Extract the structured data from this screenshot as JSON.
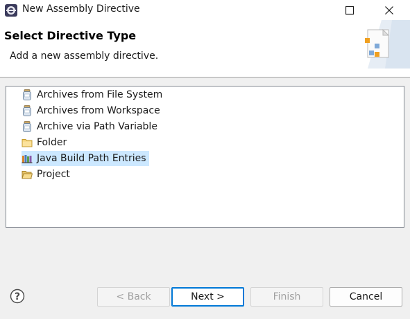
{
  "window": {
    "title": "New Assembly Directive"
  },
  "header": {
    "title": "Select Directive Type",
    "description": "Add a new assembly directive."
  },
  "list": {
    "items": [
      {
        "label": "Archives from File System",
        "icon": "jar-icon"
      },
      {
        "label": "Archives from Workspace",
        "icon": "jar-icon"
      },
      {
        "label": "Archive via Path Variable",
        "icon": "jar-icon"
      },
      {
        "label": "Folder",
        "icon": "folder-icon"
      },
      {
        "label": "Java Build Path Entries",
        "icon": "library-icon",
        "selected": true
      },
      {
        "label": "Project",
        "icon": "project-folder-icon"
      }
    ]
  },
  "buttons": {
    "back": "< Back",
    "next": "Next >",
    "finish": "Finish",
    "cancel": "Cancel"
  },
  "colors": {
    "selection": "#cce8ff",
    "default_button_border": "#0078d7",
    "dialog_background": "#f0f0f0"
  }
}
